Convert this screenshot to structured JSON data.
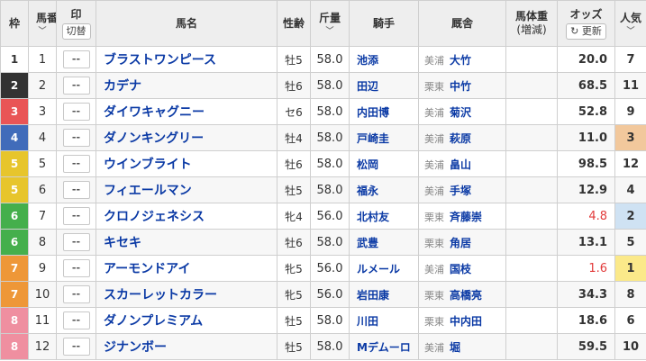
{
  "headers": {
    "waku": "枠",
    "umaban": "馬番",
    "mark": "印",
    "mark_toggle": "切替",
    "horse": "馬名",
    "sexage": "性齢",
    "weight": "斤量",
    "jockey": "騎手",
    "trainer": "厩舎",
    "body_weight": "馬体重",
    "body_weight_sub": "(増減)",
    "odds": "オッズ",
    "refresh": "更新",
    "popularity": "人気"
  },
  "icons": {
    "sort": "chevron-down-icon",
    "refresh": "refresh-icon"
  },
  "colors": {
    "waku1": "#ffffff",
    "waku2": "#333333",
    "waku3": "#e95556",
    "waku4": "#416cba",
    "waku5": "#e7c52c",
    "waku6": "#45af4c",
    "waku7": "#ee9738",
    "waku8": "#ef8fa0",
    "link": "#0b3aa5",
    "odds_hot": "#e23b3b"
  },
  "rows": [
    {
      "waku": "1",
      "umaban": "1",
      "mark": "--",
      "horse": "ブラストワンピース",
      "sexage": "牡5",
      "weight": "58.0",
      "jockey": "池添",
      "area": "美浦",
      "trainer": "大竹",
      "odds": "20.0",
      "pop": "7"
    },
    {
      "waku": "2",
      "umaban": "2",
      "mark": "--",
      "horse": "カデナ",
      "sexage": "牡6",
      "weight": "58.0",
      "jockey": "田辺",
      "area": "栗東",
      "trainer": "中竹",
      "odds": "68.5",
      "pop": "11"
    },
    {
      "waku": "3",
      "umaban": "3",
      "mark": "--",
      "horse": "ダイワキャグニー",
      "sexage": "セ6",
      "weight": "58.0",
      "jockey": "内田博",
      "area": "美浦",
      "trainer": "菊沢",
      "odds": "52.8",
      "pop": "9"
    },
    {
      "waku": "4",
      "umaban": "4",
      "mark": "--",
      "horse": "ダノンキングリー",
      "sexage": "牡4",
      "weight": "58.0",
      "jockey": "戸崎圭",
      "area": "美浦",
      "trainer": "萩原",
      "odds": "11.0",
      "pop": "3"
    },
    {
      "waku": "5",
      "umaban": "5",
      "mark": "--",
      "horse": "ウインブライト",
      "sexage": "牡6",
      "weight": "58.0",
      "jockey": "松岡",
      "area": "美浦",
      "trainer": "畠山",
      "odds": "98.5",
      "pop": "12"
    },
    {
      "waku": "5",
      "umaban": "6",
      "mark": "--",
      "horse": "フィエールマン",
      "sexage": "牡5",
      "weight": "58.0",
      "jockey": "福永",
      "area": "美浦",
      "trainer": "手塚",
      "odds": "12.9",
      "pop": "4"
    },
    {
      "waku": "6",
      "umaban": "7",
      "mark": "--",
      "horse": "クロノジェネシス",
      "sexage": "牝4",
      "weight": "56.0",
      "jockey": "北村友",
      "area": "栗東",
      "trainer": "斉藤崇",
      "odds": "4.8",
      "pop": "2"
    },
    {
      "waku": "6",
      "umaban": "8",
      "mark": "--",
      "horse": "キセキ",
      "sexage": "牡6",
      "weight": "58.0",
      "jockey": "武豊",
      "area": "栗東",
      "trainer": "角居",
      "odds": "13.1",
      "pop": "5"
    },
    {
      "waku": "7",
      "umaban": "9",
      "mark": "--",
      "horse": "アーモンドアイ",
      "sexage": "牝5",
      "weight": "56.0",
      "jockey": "ルメール",
      "area": "美浦",
      "trainer": "国枝",
      "odds": "1.6",
      "pop": "1"
    },
    {
      "waku": "7",
      "umaban": "10",
      "mark": "--",
      "horse": "スカーレットカラー",
      "sexage": "牝5",
      "weight": "56.0",
      "jockey": "岩田康",
      "area": "栗東",
      "trainer": "高橋亮",
      "odds": "34.3",
      "pop": "8"
    },
    {
      "waku": "8",
      "umaban": "11",
      "mark": "--",
      "horse": "ダノンプレミアム",
      "sexage": "牡5",
      "weight": "58.0",
      "jockey": "川田",
      "area": "栗東",
      "trainer": "中内田",
      "odds": "18.6",
      "pop": "6"
    },
    {
      "waku": "8",
      "umaban": "12",
      "mark": "--",
      "horse": "ジナンボー",
      "sexage": "牡5",
      "weight": "58.0",
      "jockey": "Mデムーロ",
      "area": "美浦",
      "trainer": "堀",
      "odds": "59.5",
      "pop": "10"
    }
  ]
}
